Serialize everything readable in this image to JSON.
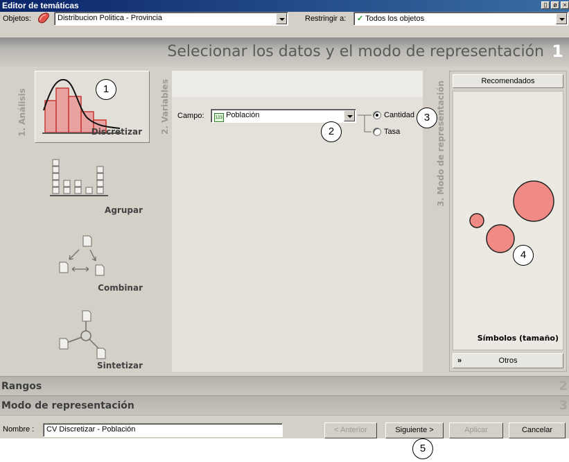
{
  "window": {
    "title": "Editor de temáticas",
    "controls": [
      "▯",
      "ø",
      "×"
    ]
  },
  "objects_row": {
    "objetos_label": "Objetos:",
    "objetos_value": "Distribucion Politica - Provincia",
    "restringir_label": "Restringir a:",
    "restringir_value": "Todos los objetos"
  },
  "banner": {
    "heading": "Selecionar los datos y el modo de representación",
    "step": "1"
  },
  "analysis": {
    "side_label": "1. Análisis",
    "items": [
      {
        "label": "Discretizar",
        "selected": true
      },
      {
        "label": "Agrupar",
        "selected": false
      },
      {
        "label": "Combinar",
        "selected": false
      },
      {
        "label": "Sintetizar",
        "selected": false
      }
    ]
  },
  "variables": {
    "side_label": "2. Variables",
    "campo_label": "Campo:",
    "campo_value": "Población",
    "campo_icon": "123",
    "options": [
      {
        "label": "Cantidad",
        "selected": true
      },
      {
        "label": "Tasa",
        "selected": false
      }
    ]
  },
  "representation": {
    "side_label": "3. Modo de representación",
    "recommended_label": "Recomendados",
    "current_label": "Símbolos (tamaño)",
    "otros_label": "Otros",
    "symbol_color": "#f08a84"
  },
  "sections": [
    {
      "title": "Rangos",
      "number": "2"
    },
    {
      "title": "Modo de representación",
      "number": "3"
    }
  ],
  "bottom": {
    "nombre_label": "Nombre :",
    "nombre_value": "CV Discretizar - Población",
    "buttons": {
      "anterior": "< Anterior",
      "siguiente": "Siguiente >",
      "aplicar": "Aplicar",
      "cancelar": "Cancelar"
    }
  },
  "callouts": [
    "1",
    "2",
    "3",
    "4",
    "5"
  ]
}
